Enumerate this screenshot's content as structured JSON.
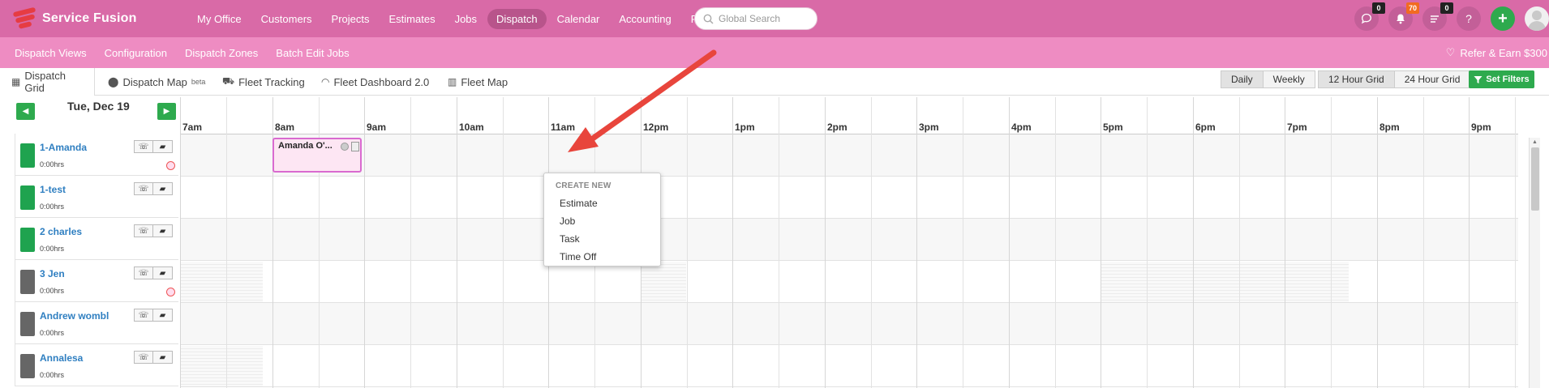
{
  "brand": {
    "name": "Service Fusion",
    "colors": {
      "nav": "#d96aa7",
      "subnav": "#ee8cc2",
      "accent": "#2eaa4e",
      "link": "#2f7fc1"
    }
  },
  "nav": {
    "items": [
      {
        "label": "My Office",
        "active": false
      },
      {
        "label": "Customers",
        "active": false
      },
      {
        "label": "Projects",
        "active": false
      },
      {
        "label": "Estimates",
        "active": false
      },
      {
        "label": "Jobs",
        "active": false
      },
      {
        "label": "Dispatch",
        "active": true
      },
      {
        "label": "Calendar",
        "active": false
      },
      {
        "label": "Accounting",
        "active": false
      },
      {
        "label": "Reports",
        "active": false
      }
    ],
    "search_placeholder": "Global Search",
    "chat_count": "0",
    "notification_count": "70",
    "tasks_count": "0",
    "help_label": "?",
    "add_label": "+"
  },
  "subnav": {
    "items": [
      "Dispatch Views",
      "Configuration",
      "Dispatch Zones",
      "Batch Edit Jobs"
    ],
    "refer": "Refer & Earn $300"
  },
  "toolbar": {
    "tabs": [
      {
        "label": "Dispatch Grid",
        "icon": "grid-icon",
        "sup": ""
      },
      {
        "label": "Dispatch Map",
        "icon": "map-pin-icon",
        "sup": "beta"
      },
      {
        "label": "Fleet Tracking",
        "icon": "truck-icon",
        "sup": ""
      },
      {
        "label": "Fleet Dashboard 2.0",
        "icon": "gauge-icon",
        "sup": ""
      },
      {
        "label": "Fleet Map",
        "icon": "map-icon",
        "sup": ""
      }
    ],
    "view_daily": "Daily",
    "view_weekly": "Weekly",
    "grid_12": "12 Hour Grid",
    "grid_24": "24 Hour Grid",
    "set_filters": "Set Filters"
  },
  "grid": {
    "date": "Tue, Dec 19",
    "hours": [
      "7am",
      "8am",
      "9am",
      "10am",
      "11am",
      "12pm",
      "1pm",
      "2pm",
      "3pm",
      "4pm",
      "5pm",
      "6pm",
      "7pm",
      "8pm",
      "9pm"
    ],
    "technicians": [
      {
        "name": "1-Amanda",
        "hours": "0:00hrs",
        "color": "#1fa34f",
        "status_dot": true
      },
      {
        "name": "1-test",
        "hours": "0:00hrs",
        "color": "#1fa34f",
        "status_dot": false
      },
      {
        "name": "2 charles",
        "hours": "0:00hrs",
        "color": "#1fa34f",
        "status_dot": false
      },
      {
        "name": "3 Jen",
        "hours": "0:00hrs",
        "color": "#666666",
        "status_dot": true
      },
      {
        "name": "Andrew wombl",
        "hours": "0:00hrs",
        "color": "#666666",
        "status_dot": false
      },
      {
        "name": "Annalesa",
        "hours": "0:00hrs",
        "color": "#666666",
        "status_dot": false
      }
    ],
    "job": {
      "title": "Amanda O'..."
    }
  },
  "context_menu": {
    "header": "CREATE NEW",
    "items": [
      "Estimate",
      "Job",
      "Task",
      "Time Off"
    ]
  }
}
